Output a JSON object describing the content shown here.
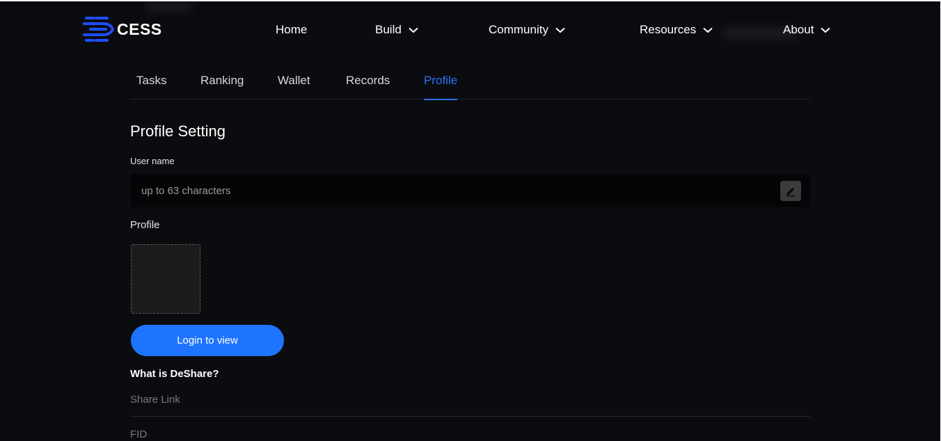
{
  "header": {
    "logo_text": "CESS",
    "nav": [
      {
        "label": "Home",
        "has_dropdown": false
      },
      {
        "label": "Build",
        "has_dropdown": true
      },
      {
        "label": "Community",
        "has_dropdown": true
      },
      {
        "label": "Resources",
        "has_dropdown": true
      },
      {
        "label": "About",
        "has_dropdown": true
      }
    ]
  },
  "tabs": [
    {
      "label": "Tasks",
      "active": false
    },
    {
      "label": "Ranking",
      "active": false
    },
    {
      "label": "Wallet",
      "active": false
    },
    {
      "label": "Records",
      "active": false
    },
    {
      "label": "Profile",
      "active": true
    }
  ],
  "profile_setting": {
    "title": "Profile Setting",
    "username_label": "User name",
    "username_placeholder": "up to 63 characters",
    "username_value": "",
    "edit_icon": "pencil-icon",
    "profile_label": "Profile",
    "login_button": "Login to view",
    "deshare_link": "What is DeShare?",
    "share_link_label": "Share Link",
    "fid_label": "FID"
  },
  "colors": {
    "background": "#0b0c10",
    "accent": "#1f74ff",
    "active_tab": "#2b73ff",
    "input_bg": "#050507"
  }
}
